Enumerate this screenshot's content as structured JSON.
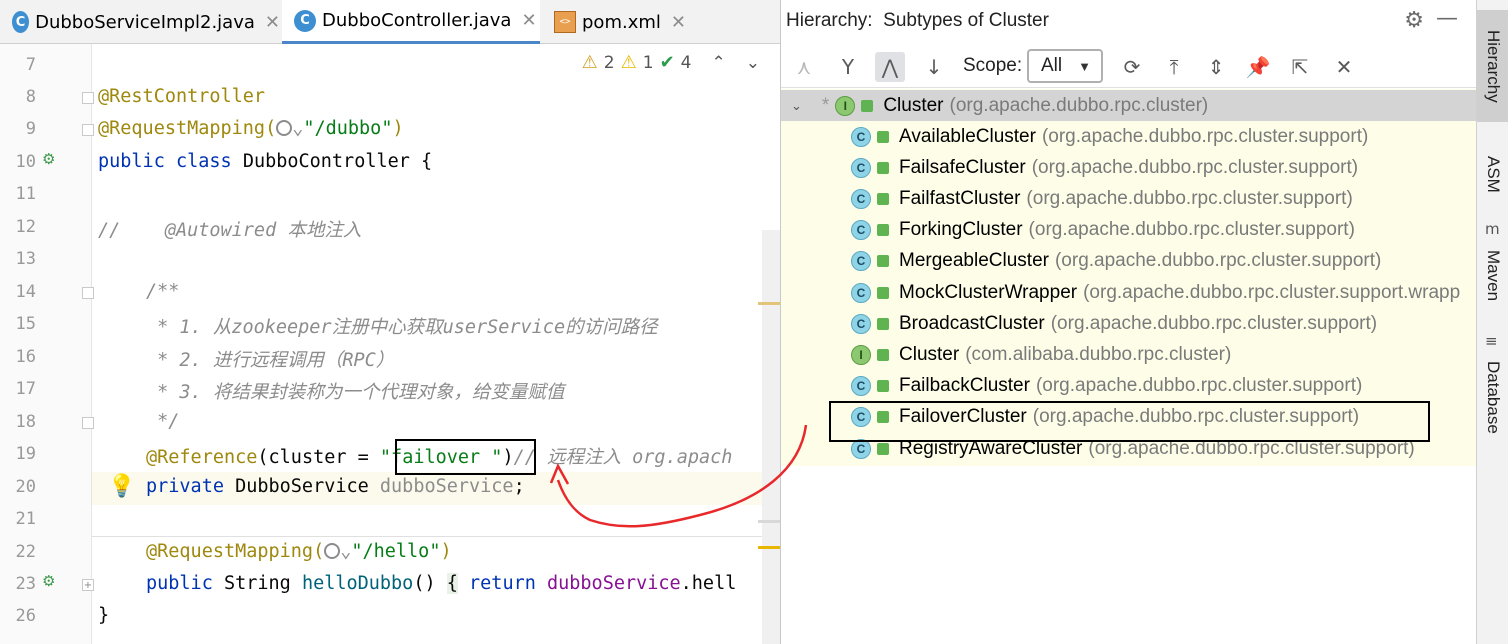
{
  "tabs": [
    {
      "label": "DubboServiceImpl2.java",
      "icon": "java-class-icon",
      "active": false
    },
    {
      "label": "DubboController.java",
      "icon": "java-class-icon",
      "active": true
    },
    {
      "label": "pom.xml",
      "icon": "xml-file-icon",
      "active": false
    }
  ],
  "inspections": {
    "warnings": "2",
    "weak_warnings": "1",
    "typos": "4"
  },
  "editor_lines": {
    "l7": "7",
    "l8": "8",
    "l9": "9",
    "l10": "10",
    "l11": "11",
    "l12": "12",
    "l13": "13",
    "l14": "14",
    "l15": "15",
    "l16": "16",
    "l17": "17",
    "l18": "18",
    "l19": "19",
    "l20": "20",
    "l21": "21",
    "l22": "22",
    "l23": "23",
    "l26": "26"
  },
  "code": {
    "rest_controller": "@RestController",
    "request_mapping": "@RequestMapping(",
    "dubbo_path": "\"/dubbo\"",
    "close_paren": ")",
    "public": "public",
    "class": "class",
    "class_name": "DubboController {",
    "comment_autowired": "//    @Autowired 本地注入",
    "javadoc_open": "/**",
    "javadoc_1": " * 1. 从zookeeper注册中心获取userService的访问路径",
    "javadoc_2": " * 2. 进行远程调用（RPC）",
    "javadoc_3": " * 3. 将结果封装称为一个代理对象，给变量赋值",
    "javadoc_close": " */",
    "reference": "@Reference",
    "cluster_arg": "(cluster = ",
    "failover_str": "\"failover \"",
    "ref_comment": "// 远程注入 org.apach",
    "private": "private",
    "service_type": "DubboService",
    "service_field": "dubboService",
    "semicolon": ";",
    "hello_path": "\"/hello\"",
    "string_type": "String",
    "hello_method": "helloDubbo",
    "hello_parens": "()",
    "brace_open": "{",
    "return": "return",
    "hello_call": "dubboService",
    "hello_call_tail": ".hell",
    "closing_brace": "}"
  },
  "hierarchy": {
    "title": "Hierarchy:",
    "subtitle": "Subtypes of Cluster",
    "scope_label": "Scope:",
    "scope_value": "All",
    "root": {
      "name": "Cluster",
      "package": "(org.apache.dubbo.rpc.cluster)",
      "kind": "I"
    },
    "items": [
      {
        "name": "AvailableCluster",
        "package": "(org.apache.dubbo.rpc.cluster.support)",
        "kind": "C"
      },
      {
        "name": "FailsafeCluster",
        "package": "(org.apache.dubbo.rpc.cluster.support)",
        "kind": "C"
      },
      {
        "name": "FailfastCluster",
        "package": "(org.apache.dubbo.rpc.cluster.support)",
        "kind": "C"
      },
      {
        "name": "ForkingCluster",
        "package": "(org.apache.dubbo.rpc.cluster.support)",
        "kind": "C"
      },
      {
        "name": "MergeableCluster",
        "package": "(org.apache.dubbo.rpc.cluster.support)",
        "kind": "C"
      },
      {
        "name": "MockClusterWrapper",
        "package": "(org.apache.dubbo.rpc.cluster.support.wrapp",
        "kind": "C"
      },
      {
        "name": "BroadcastCluster",
        "package": "(org.apache.dubbo.rpc.cluster.support)",
        "kind": "C"
      },
      {
        "name": "Cluster",
        "package": "(com.alibaba.dubbo.rpc.cluster)",
        "kind": "I"
      },
      {
        "name": "FailbackCluster",
        "package": "(org.apache.dubbo.rpc.cluster.support)",
        "kind": "C"
      },
      {
        "name": "FailoverCluster",
        "package": "(org.apache.dubbo.rpc.cluster.support)",
        "kind": "C"
      },
      {
        "name": "RegistryAwareCluster",
        "package": "(org.apache.dubbo.rpc.cluster.support)",
        "kind": "C"
      }
    ]
  },
  "side_tabs": {
    "hierarchy": "Hierarchy",
    "asm": "ASM",
    "maven": "Maven",
    "database": "Database"
  },
  "colors": {
    "accent": "#4a86c8",
    "tree_bg": "#fefde8",
    "annotation": "#9e880d",
    "keyword": "#0033b3",
    "string": "#067d17",
    "arrow": "#e8282b"
  }
}
